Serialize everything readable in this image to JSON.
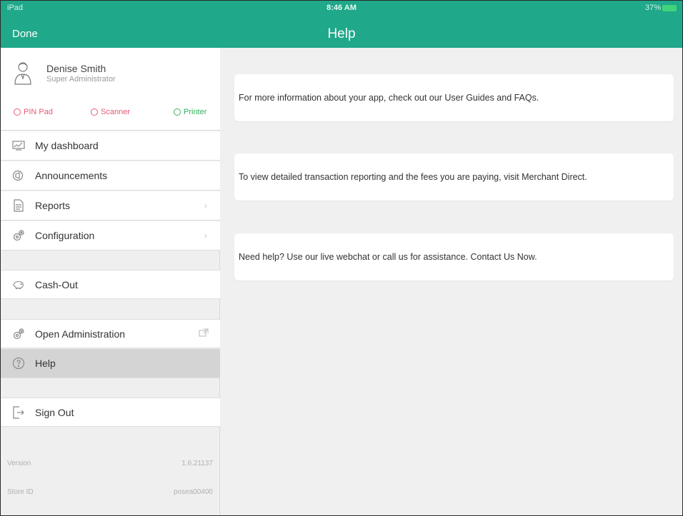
{
  "status_bar": {
    "carrier": "iPad",
    "time": "8:46 AM",
    "battery": "37%"
  },
  "nav": {
    "done_label": "Done",
    "title": "Help"
  },
  "profile": {
    "name": "Denise Smith",
    "role": "Super Administrator"
  },
  "devices": [
    {
      "label": "PIN Pad",
      "status": "disconnected",
      "color": "#e85a6e"
    },
    {
      "label": "Scanner",
      "status": "disconnected",
      "color": "#e85a6e"
    },
    {
      "label": "Printer",
      "status": "connected",
      "color": "#36b15a"
    }
  ],
  "menu": {
    "dashboard": "My dashboard",
    "announcements": "Announcements",
    "reports": "Reports",
    "configuration": "Configuration",
    "cash_out": "Cash-Out",
    "open_admin": "Open Administration",
    "help": "Help",
    "sign_out": "Sign Out"
  },
  "info": {
    "version_label": "Version",
    "version_value": "1.6.21137",
    "store_label": "Store ID",
    "store_value": "posea00400"
  },
  "cards": [
    {
      "text": "For more information about your app, check out our User Guides and FAQs."
    },
    {
      "text": "To view detailed transaction reporting and the fees you are paying, visit Merchant Direct."
    },
    {
      "text": "Need help? Use our live webchat or call us for assistance. Contact Us Now."
    }
  ],
  "colors": {
    "accent": "#1fa889",
    "active_row": "#d4d4d4"
  }
}
